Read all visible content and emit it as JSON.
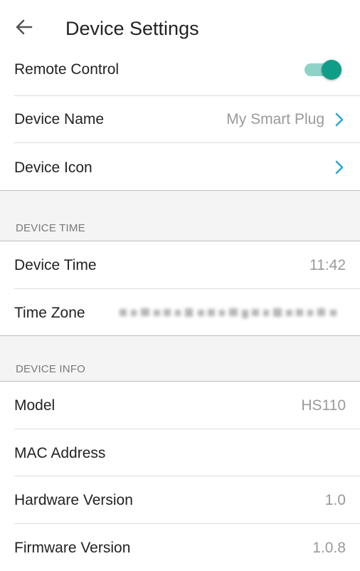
{
  "header": {
    "title": "Device Settings",
    "back_icon": "arrow-left-icon"
  },
  "remote_control": {
    "label": "Remote Control",
    "enabled": true,
    "accent_color": "#0f9d87",
    "track_color": "#8fd3c8"
  },
  "device_name": {
    "label": "Device Name",
    "value": "My Smart Plug",
    "chevron_icon": "chevron-right-icon",
    "chevron_color": "#29a8e0"
  },
  "device_icon": {
    "label": "Device Icon",
    "chevron_icon": "chevron-right-icon"
  },
  "section_time": {
    "title": "DEVICE TIME"
  },
  "device_time": {
    "label": "Device Time",
    "value": "11:42"
  },
  "time_zone": {
    "label": "Time Zone"
  },
  "section_info": {
    "title": "DEVICE INFO"
  },
  "model": {
    "label": "Model",
    "value": "HS110"
  },
  "mac_address": {
    "label": "MAC Address"
  },
  "hardware_version": {
    "label": "Hardware Version",
    "value": "1.0"
  },
  "firmware_version": {
    "label": "Firmware Version",
    "value": "1.0.8"
  }
}
